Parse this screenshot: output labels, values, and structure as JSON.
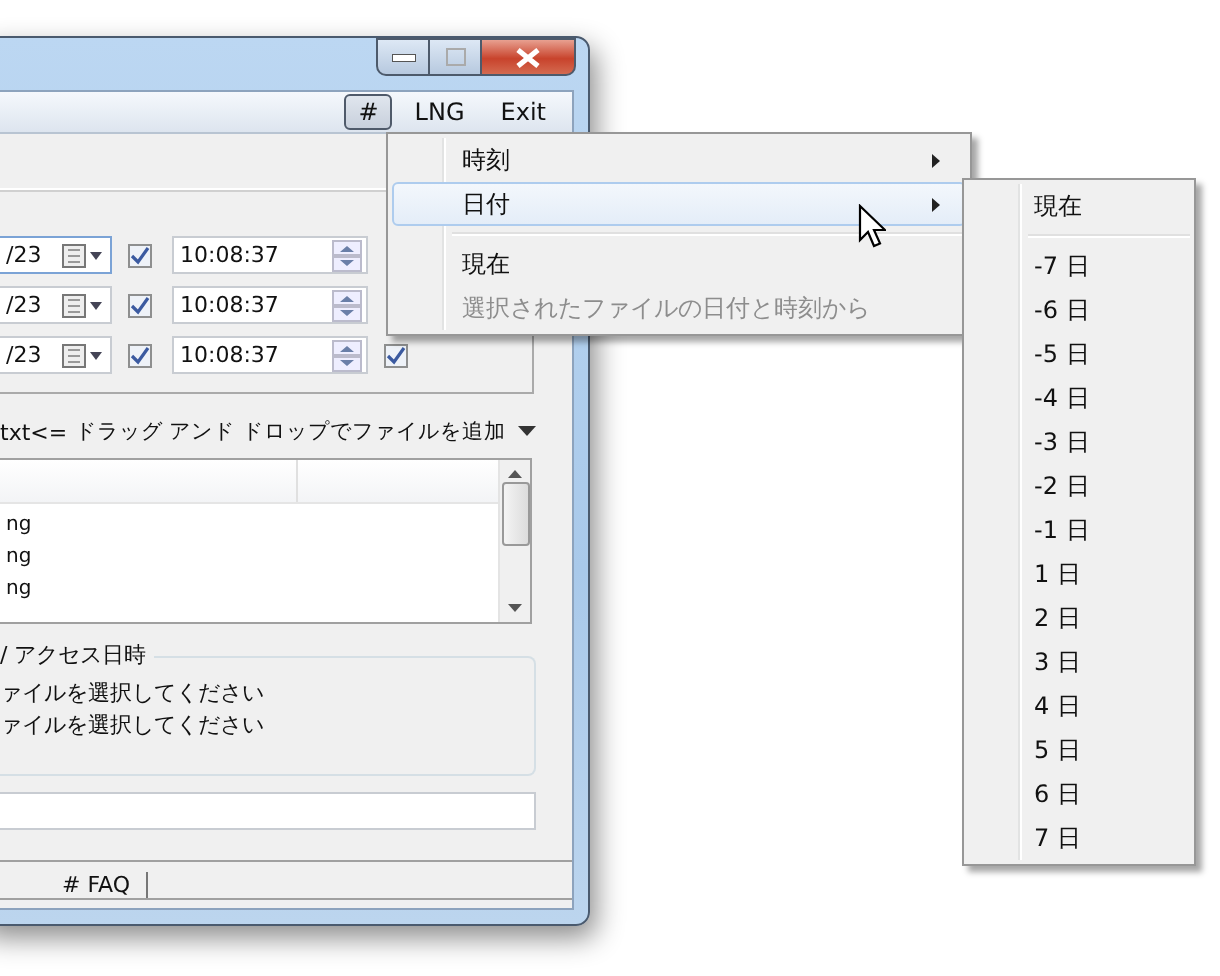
{
  "menu_bar": [
    {
      "label": "#",
      "selected": true
    },
    {
      "label": "LNG",
      "selected": false
    },
    {
      "label": "Exit",
      "selected": false
    }
  ],
  "date_rows": [
    {
      "date": "/23",
      "date_checked": true,
      "time": "10:08:37"
    },
    {
      "date": "/23",
      "date_checked": true,
      "time": "10:08:37"
    },
    {
      "date": "/23",
      "date_checked": true,
      "time": "10:08:37",
      "trailing_checked": true
    }
  ],
  "drop_bar": {
    "filter": "txt<=",
    "drop_label": "ドラッグ アンド ドロップでファイルを追加"
  },
  "file_list": {
    "rows": [
      "ng",
      "ng",
      "ng"
    ]
  },
  "timestamps": {
    "legend": "/ アクセス日時",
    "lines": [
      "ァイルを選択してください",
      "ァイルを選択してください"
    ]
  },
  "footer_tabs": [
    "# FAQ"
  ],
  "context_menu": {
    "items": [
      {
        "kind": "submenu",
        "label": "時刻",
        "selected": false,
        "disabled": false
      },
      {
        "kind": "submenu",
        "label": "日付",
        "selected": true,
        "disabled": false
      },
      {
        "kind": "separator"
      },
      {
        "kind": "item",
        "label": "現在",
        "selected": false,
        "disabled": false
      },
      {
        "kind": "item",
        "label": "選択されたファイルの日付と時刻から",
        "selected": false,
        "disabled": true
      }
    ]
  },
  "submenu": {
    "items": [
      {
        "kind": "item",
        "label": "現在",
        "selected": false
      },
      {
        "kind": "separator"
      },
      {
        "kind": "item",
        "label": "-7 日",
        "selected": false
      },
      {
        "kind": "item",
        "label": "-6 日",
        "selected": false
      },
      {
        "kind": "item",
        "label": "-5 日",
        "selected": false
      },
      {
        "kind": "item",
        "label": "-4 日",
        "selected": false
      },
      {
        "kind": "item",
        "label": "-3 日",
        "selected": false
      },
      {
        "kind": "item",
        "label": "-2 日",
        "selected": false
      },
      {
        "kind": "item",
        "label": "-1 日",
        "selected": false
      },
      {
        "kind": "item",
        "label": "1 日",
        "selected": false
      },
      {
        "kind": "item",
        "label": "2 日",
        "selected": false
      },
      {
        "kind": "item",
        "label": "3 日",
        "selected": false
      },
      {
        "kind": "item",
        "label": "4 日",
        "selected": false
      },
      {
        "kind": "item",
        "label": "5 日",
        "selected": false
      },
      {
        "kind": "item",
        "label": "6 日",
        "selected": false
      },
      {
        "kind": "item",
        "label": "7 日",
        "selected": false
      }
    ]
  }
}
